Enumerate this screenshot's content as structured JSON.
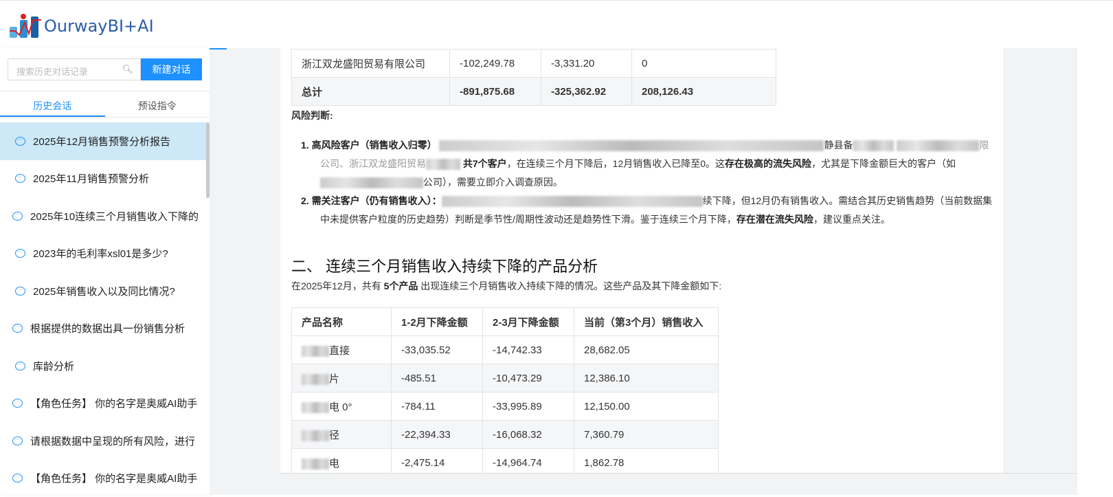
{
  "header": {
    "brand": "OurwayBI+AI"
  },
  "sidebar": {
    "search_placeholder": "搜索历史对话记录",
    "new_chat": "新建对话",
    "tabs": [
      "历史会话",
      "预设指令"
    ],
    "items": [
      "2025年12月销售预警分析报告",
      "2025年11月销售预警分析",
      "2025年10连续三个月销售收入下降的",
      "2023年的毛利率xsl01是多少?",
      "2025年销售收入以及同比情况?",
      "根据提供的数据出具一份销售分析",
      "库龄分析",
      "【角色任务】 你的名字是奥威AI助手",
      "请根据数据中呈现的所有风险，进行",
      "【角色任务】 你的名字是奥威AI助手"
    ]
  },
  "table1": {
    "rows": [
      [
        "浙江双龙盛阳贸易有限公司",
        "-102,249.78",
        "-3,331.20",
        "0"
      ]
    ],
    "total": [
      "总计",
      "-891,875.68",
      "-325,362.92",
      "208,126.43"
    ]
  },
  "risk": {
    "title": "风险判断:",
    "p1_label": "1. 高风险客户（销售收入归零）",
    "p1_frag1": "静县备",
    "p1_frag2": "限公司、浙江双龙盛阳贸易",
    "p1_bold1": "共7个客户",
    "p1_text1": "，在连续三个月下降后，12月销售收入已降至0。这",
    "p1_bold2": "存在极高的流失风险",
    "p1_text2": "，尤其是下降金额巨大的客户（如",
    "p1_text3": "公司），需要立即介入调查原因。",
    "p2_label": "2. 需关注客户（仍有销售收入）：",
    "p2_text1": "续下降，但12月仍有销售收入。需结合其历史销售趋势（当前数据集中未提供客户粒度的历史趋势）判断是季节性/周期性波动还是趋势性下滑。鉴于连续三个月下降，",
    "p2_bold": "存在潜在流失风险",
    "p2_text2": "，建议重点关注。"
  },
  "section2": {
    "title": "二、 连续三个月销售收入持续下降的产品分析",
    "intro1": "在2025年12月，共有 ",
    "intro_bold": "5个产品",
    "intro2": " 出现连续三个月销售收入持续下降的情况。这些产品及其下降金额如下:",
    "headers": [
      "产品名称",
      "1-2月下降金额",
      "2-3月下降金额",
      "当前（第3个月）销售收入"
    ],
    "rows": [
      [
        "直接",
        "-33,035.52",
        "-14,742.33",
        "28,682.05"
      ],
      [
        "片",
        "-485.51",
        "-10,473.29",
        "12,386.10"
      ],
      [
        "电 0°",
        "-784.11",
        "-33,995.89",
        "12,150.00"
      ],
      [
        "径",
        "-22,394.33",
        "-16,068.32",
        "7,360.79"
      ],
      [
        "电",
        "-2,475.14",
        "-14,964.74",
        "1,862.78"
      ]
    ]
  }
}
